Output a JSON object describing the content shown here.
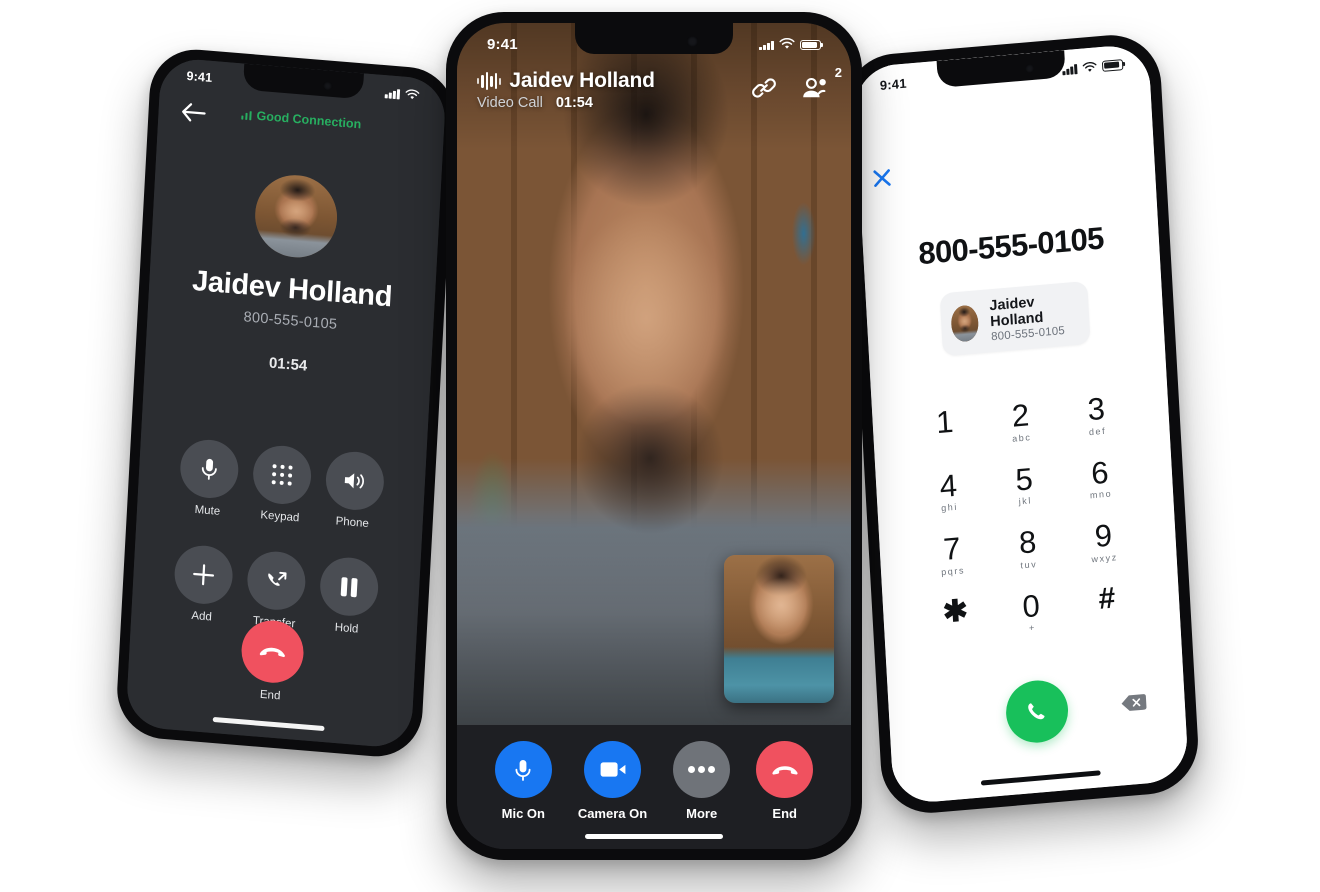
{
  "left_phone": {
    "status_bar": {
      "time": "9:41",
      "signal_icon": "cellular-signal-icon",
      "wifi_icon": "wifi-icon"
    },
    "back_icon": "back-arrow-icon",
    "connection": {
      "label": "Good Connection",
      "icon": "signal-bars-icon",
      "color": "#27ae60"
    },
    "avatar": "contact-avatar",
    "contact_name": "Jaidev Holland",
    "contact_number": "800-555-0105",
    "timer": "01:54",
    "controls": [
      {
        "label": "Mute",
        "icon": "microphone-icon"
      },
      {
        "label": "Keypad",
        "icon": "keypad-dots-icon"
      },
      {
        "label": "Phone",
        "icon": "speaker-icon"
      },
      {
        "label": "Add",
        "icon": "plus-icon"
      },
      {
        "label": "Transfer",
        "icon": "call-transfer-icon"
      },
      {
        "label": "Hold",
        "icon": "pause-icon"
      }
    ],
    "end_button": {
      "label": "End",
      "icon": "hangup-icon",
      "color": "#f0515f"
    }
  },
  "center_phone": {
    "status_bar": {
      "time": "9:41",
      "signal_icon": "cellular-signal-icon",
      "wifi_icon": "wifi-icon",
      "battery_icon": "battery-icon"
    },
    "header": {
      "waveform_icon": "audio-waveform-icon",
      "name": "Jaidev Holland",
      "call_type": "Video Call",
      "duration": "01:54",
      "link_icon": "link-icon",
      "participants_icon": "participants-icon",
      "participants_count": "2"
    },
    "main_video": "remote-participant-video",
    "pip_video": "self-view-video",
    "controls": [
      {
        "label": "Mic On",
        "icon": "microphone-icon",
        "color": "#1877f2"
      },
      {
        "label": "Camera On",
        "icon": "video-camera-icon",
        "color": "#1877f2"
      },
      {
        "label": "More",
        "icon": "more-dots-icon",
        "color": "#6f7379"
      },
      {
        "label": "End",
        "icon": "hangup-icon",
        "color": "#f0515f"
      }
    ]
  },
  "right_phone": {
    "status_bar": {
      "time": "9:41",
      "signal_icon": "cellular-signal-icon",
      "wifi_icon": "wifi-icon",
      "battery_icon": "battery-icon"
    },
    "close_icon": "close-x-icon",
    "dialed_number": "800-555-0105",
    "contact_card": {
      "avatar": "contact-avatar",
      "name": "Jaidev Holland",
      "number": "800-555-0105"
    },
    "keys": [
      {
        "digit": "1",
        "letters": ""
      },
      {
        "digit": "2",
        "letters": "abc"
      },
      {
        "digit": "3",
        "letters": "def"
      },
      {
        "digit": "4",
        "letters": "ghi"
      },
      {
        "digit": "5",
        "letters": "jkl"
      },
      {
        "digit": "6",
        "letters": "mno"
      },
      {
        "digit": "7",
        "letters": "pqrs"
      },
      {
        "digit": "8",
        "letters": "tuv"
      },
      {
        "digit": "9",
        "letters": "wxyz"
      },
      {
        "digit": "✱",
        "letters": ""
      },
      {
        "digit": "0",
        "letters": "+"
      },
      {
        "digit": "#",
        "letters": ""
      }
    ],
    "call_button": {
      "icon": "phone-call-icon",
      "color": "#18c05b"
    },
    "delete_button": {
      "icon": "backspace-icon"
    }
  }
}
